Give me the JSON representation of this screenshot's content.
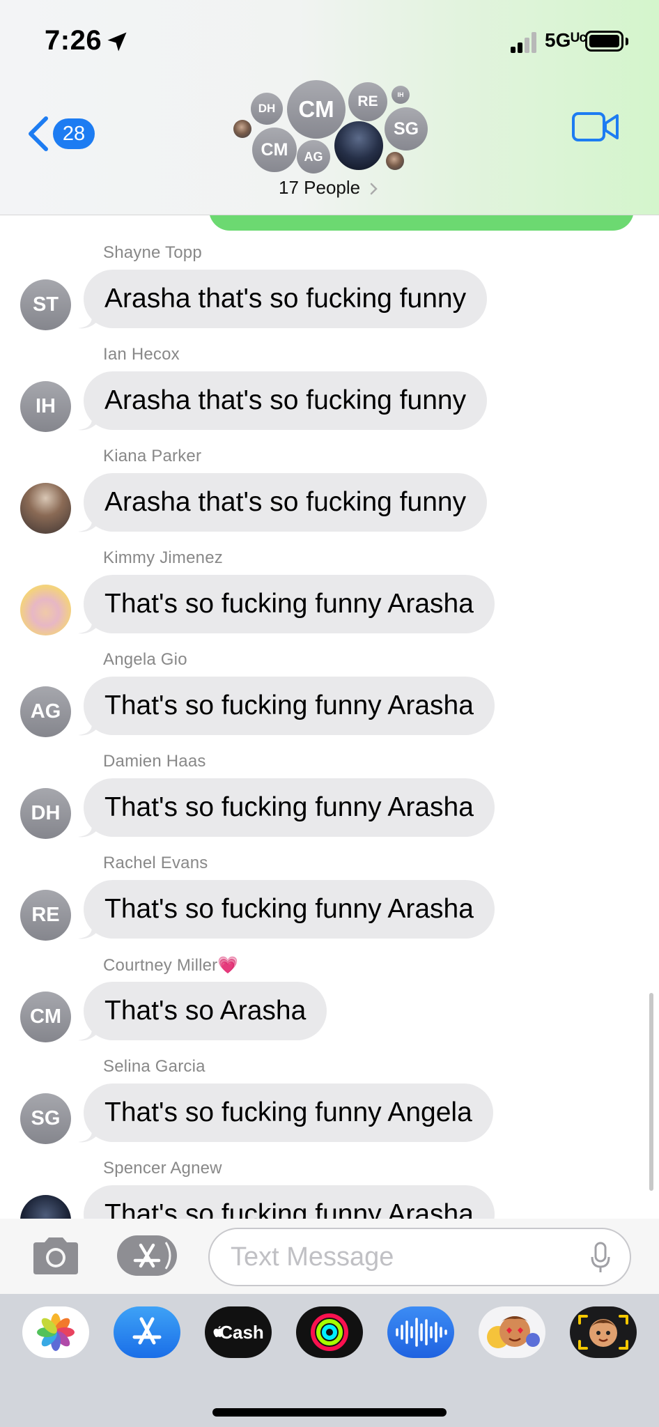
{
  "status_bar": {
    "time": "7:26",
    "network": "5Gᵁᶜ",
    "signal_bars_active": 2,
    "signal_bars_total": 4
  },
  "header": {
    "back_badge": "28",
    "people_label": "17 People",
    "group_avatars": [
      "DH",
      "CM",
      "RE",
      "IH",
      "CM",
      "AG",
      "SG"
    ]
  },
  "messages": [
    {
      "sender": "Shayne Topp",
      "initials": "ST",
      "text": "Arasha that's so fucking funny"
    },
    {
      "sender": "Ian Hecox",
      "initials": "IH",
      "text": "Arasha that's so fucking funny"
    },
    {
      "sender": "Kiana Parker",
      "initials": "",
      "text": "Arasha that's so fucking funny"
    },
    {
      "sender": "Kimmy Jimenez",
      "initials": "",
      "text": "That's so fucking funny Arasha"
    },
    {
      "sender": "Angela Gio",
      "initials": "AG",
      "text": "That's so fucking funny Arasha"
    },
    {
      "sender": "Damien Haas",
      "initials": "DH",
      "text": "That's so fucking funny Arasha"
    },
    {
      "sender": "Rachel Evans",
      "initials": "RE",
      "text": "That's so fucking funny Arasha"
    },
    {
      "sender": "Courtney Miller💗",
      "initials": "CM",
      "text": "That's so Arasha"
    },
    {
      "sender": "Selina Garcia",
      "initials": "SG",
      "text": "That's so fucking funny Angela"
    },
    {
      "sender": "Spencer Agnew",
      "initials": "",
      "text": "That's so fucking funny Arasha"
    }
  ],
  "input": {
    "placeholder": "Text Message",
    "value": ""
  },
  "app_drawer": {
    "apps": [
      "photos-icon",
      "app-store-icon",
      "Cash",
      "activity-icon",
      "audio-message-icon",
      "memoji-stickers-icon",
      "memoji-icon"
    ],
    "cash_label": "Cash"
  },
  "colors": {
    "accent_blue": "#1d7cf2",
    "sent_bubble": "#6cd971",
    "received_bubble": "#e9e9eb"
  }
}
